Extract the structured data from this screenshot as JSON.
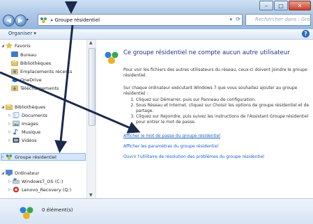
{
  "address": {
    "segment": "Groupe résidentiel",
    "search_placeholder": "Rechercher dans : Grou..."
  },
  "toolbar": {
    "organize_label": "Organiser ▾",
    "help_label": "?"
  },
  "nav": {
    "favorites": {
      "label": "Favoris",
      "items": [
        "Bureau",
        "Bibliothèques",
        "Emplacements récents",
        "OneDrive",
        "Téléchargements"
      ]
    },
    "libraries": {
      "label": "Bibliothèques",
      "items": [
        "Documents",
        "Images",
        "Musique",
        "Vidéos"
      ]
    },
    "homegroup": {
      "label": "Groupe résidentiel"
    },
    "computer": {
      "label": "Ordinateur",
      "items": [
        "Windows7_OS (C:)",
        "Lenovo_Recovery (Q:)"
      ]
    }
  },
  "content": {
    "title": "Ce groupe résidentiel ne compte aucun autre utilisateur",
    "p1": "Pour voir les fichiers des autres utilisateurs du réseau, ceux-ci doivent joindre le groupe résidentiel.",
    "p2": "Sur chaque ordinateur exécutant Windows 7 que vous souhaitez ajouter au groupe résidentiel :",
    "steps": [
      "Cliquez sur Démarrer, puis sur Panneau de configuration.",
      "Sous Réseau et Internet, cliquez sur Choisir les options de groupe résidentiel et de partage.",
      "Cliquez sur Rejoindre, puis suivez les instructions de l'Assistant Groupe résidentiel pour entrer le mot de passe."
    ],
    "links": [
      "Afficher le mot de passe du groupe résidentiel",
      "Afficher les paramètres du groupe résidentiel",
      "Ouvrir l'utilitaire de résolution des problèmes du groupe résidentiel"
    ]
  },
  "status": {
    "count": "0 élément(s)"
  },
  "colors": {
    "link": "#1a5fc8",
    "title": "#1e3287",
    "selection": "#d5e6fb"
  }
}
